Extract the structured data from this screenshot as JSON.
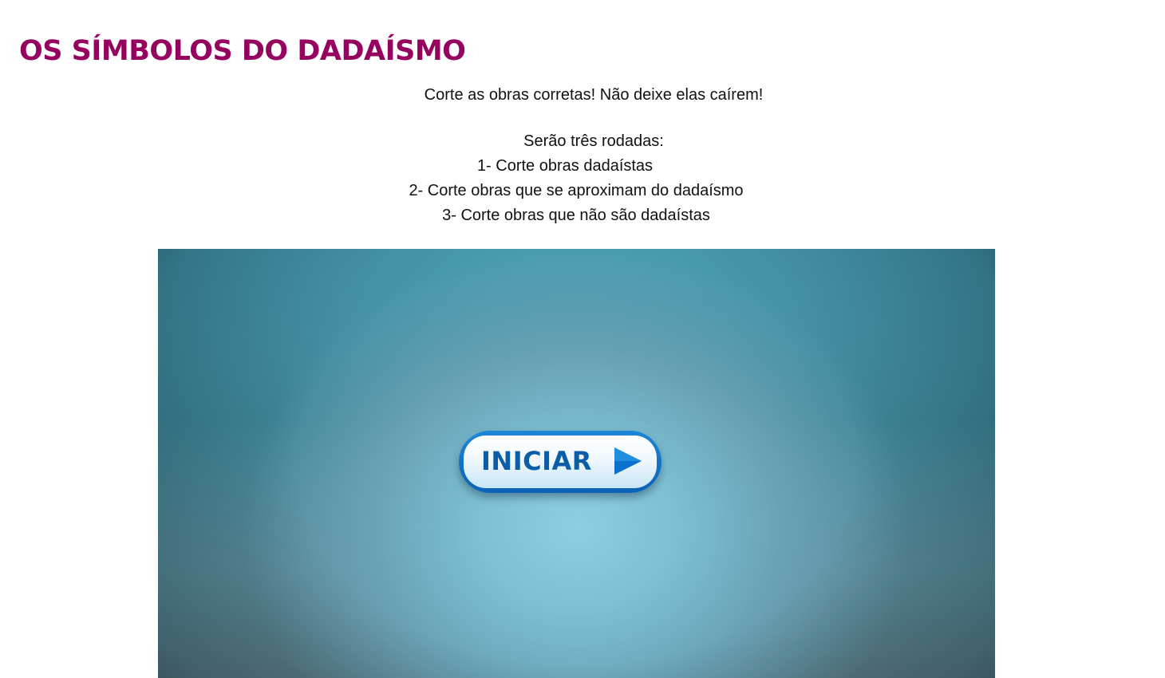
{
  "header": {
    "title": "OS SÍMBOLOS DO DADAÍSMO"
  },
  "instructions": {
    "intro": "Corte as obras corretas! Não deixe elas caírem!",
    "rounds_heading": "Serão três rodadas:",
    "rounds": [
      "1- Corte obras dadaístas",
      "2- Corte obras que se aproximam do dadaísmo",
      "3- Corte obras que não são dadaístas"
    ]
  },
  "game": {
    "start_label": "INICIAR",
    "start_icon": "play-icon",
    "colors": {
      "title": "#96005e",
      "button_border": "#0a62b6",
      "button_text": "#0a5ea8",
      "background_center": "#8fcde2",
      "background_edge": "#2f5560"
    }
  }
}
